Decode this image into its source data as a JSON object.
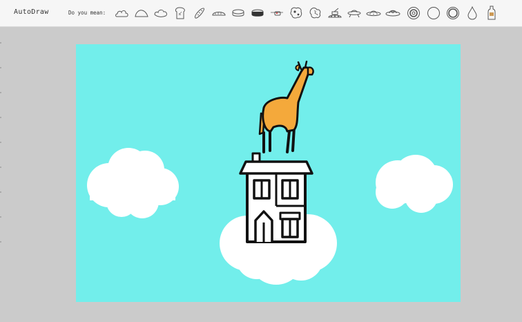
{
  "app": {
    "title": "AutoDraw"
  },
  "suggestions": {
    "prompt": "Do you mean:",
    "icons": [
      "cloud-icon",
      "hill-icon",
      "cloud-puff-icon",
      "toast-icon",
      "baguette-icon",
      "hotdog-bun-icon",
      "pill-icon",
      "hockey-puck-icon",
      "cable-car-icon",
      "cow-icon",
      "world-map-icon",
      "tank-icon",
      "ufo-icon",
      "flying-saucer-icon",
      "saucer-ring-icon",
      "donut-icon",
      "circle-icon",
      "ring-icon",
      "drop-icon",
      "bottle-icon"
    ]
  },
  "canvas": {
    "background": "#72eeeb",
    "cloud_color": "#ffffff",
    "giraffe_color": "#f4a93b",
    "outline_color": "#111111"
  }
}
